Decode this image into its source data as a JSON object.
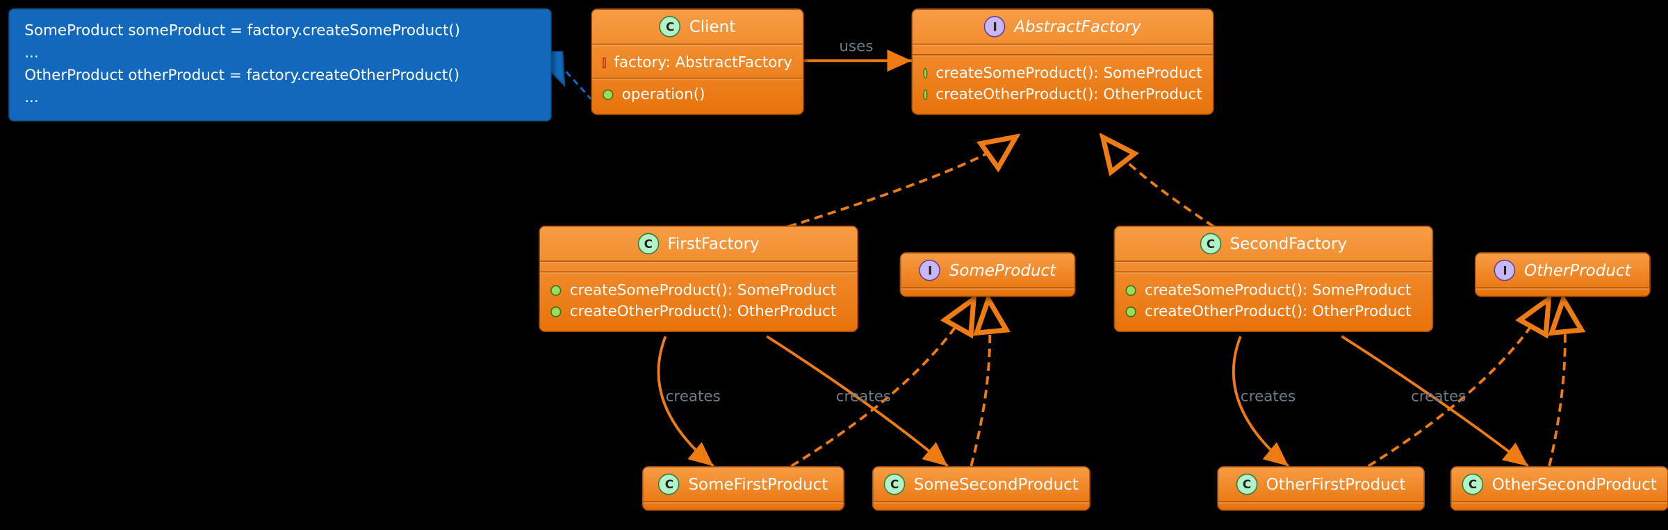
{
  "note": {
    "lines": [
      "SomeProduct someProduct = factory.createSomeProduct()",
      "...",
      "OtherProduct otherProduct = factory.createOtherProduct()",
      "..."
    ]
  },
  "classes": {
    "client": {
      "stereotype": "C",
      "name": "Client",
      "members": [
        {
          "vis": "private",
          "text": "factory: AbstractFactory"
        },
        {
          "vis": "public",
          "text": "operation()"
        }
      ]
    },
    "abstract_factory": {
      "stereotype": "I",
      "name": "AbstractFactory",
      "italic": true,
      "members": [
        {
          "vis": "public",
          "text": "createSomeProduct(): SomeProduct"
        },
        {
          "vis": "public",
          "text": "createOtherProduct(): OtherProduct"
        }
      ]
    },
    "first_factory": {
      "stereotype": "C",
      "name": "FirstFactory",
      "members": [
        {
          "vis": "public",
          "text": "createSomeProduct(): SomeProduct"
        },
        {
          "vis": "public",
          "text": "createOtherProduct(): OtherProduct"
        }
      ]
    },
    "second_factory": {
      "stereotype": "C",
      "name": "SecondFactory",
      "members": [
        {
          "vis": "public",
          "text": "createSomeProduct(): SomeProduct"
        },
        {
          "vis": "public",
          "text": "createOtherProduct(): OtherProduct"
        }
      ]
    },
    "some_product": {
      "stereotype": "I",
      "name": "SomeProduct",
      "italic": true,
      "members": []
    },
    "other_product": {
      "stereotype": "I",
      "name": "OtherProduct",
      "italic": true,
      "members": []
    },
    "some_first_product": {
      "stereotype": "C",
      "name": "SomeFirstProduct",
      "members": []
    },
    "some_second_product": {
      "stereotype": "C",
      "name": "SomeSecondProduct",
      "members": []
    },
    "other_first_product": {
      "stereotype": "C",
      "name": "OtherFirstProduct",
      "members": []
    },
    "other_second_product": {
      "stereotype": "C",
      "name": "OtherSecondProduct",
      "members": []
    }
  },
  "edges": {
    "uses": {
      "label": "uses"
    },
    "creates1": {
      "label": "creates"
    },
    "creates2": {
      "label": "creates"
    },
    "creates3": {
      "label": "creates"
    },
    "creates4": {
      "label": "creates"
    }
  }
}
